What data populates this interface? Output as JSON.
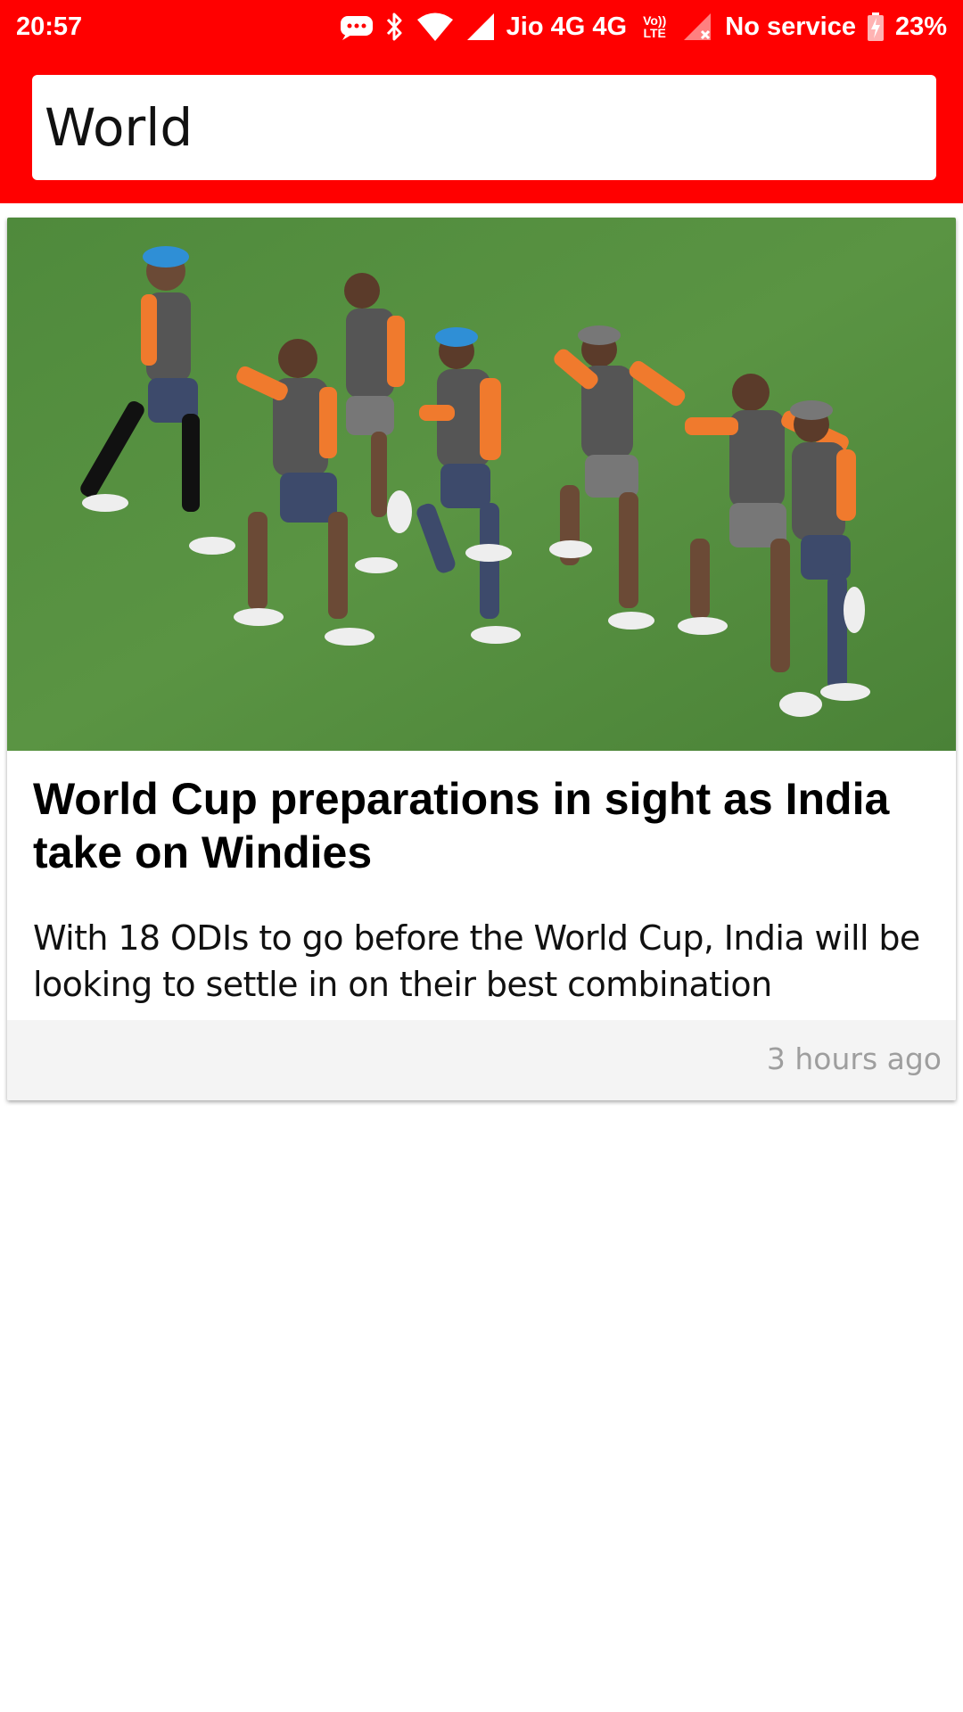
{
  "status_bar": {
    "time": "20:57",
    "carrier": "Jio 4G 4G",
    "volte_top": "Vo))",
    "volte_bottom": "LTE",
    "no_service": "No service",
    "battery": "23%",
    "icons": [
      "message-icon",
      "bluetooth-icon",
      "wifi-icon",
      "signal-icon",
      "volte-icon",
      "no-signal-icon",
      "battery-charging-icon"
    ]
  },
  "search": {
    "value": "World"
  },
  "articles": [
    {
      "image_alt": "Indian cricket players running drills on field",
      "title": "World Cup preparations in sight as India take on Windies",
      "description": "With 18 ODIs to go before the World Cup, India will be looking to settle in on their best combination",
      "time": "3 hours ago"
    }
  ],
  "colors": {
    "header": "#ff0000",
    "card_footer": "#f4f4f4",
    "time_text": "#9e9e9e"
  }
}
